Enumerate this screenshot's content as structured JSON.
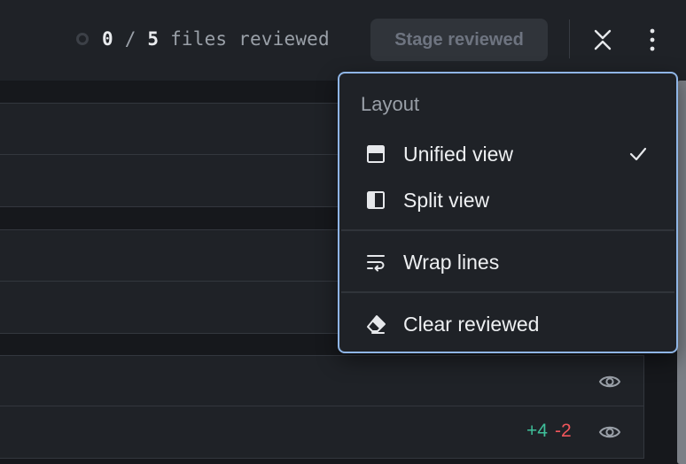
{
  "toolbar": {
    "reviewed_count": "0",
    "separator": "/",
    "total_count": "5",
    "reviewed_suffix": "files reviewed",
    "stage_label": "Stage reviewed",
    "collapse_icon": "collapse-vertical-icon",
    "more_icon": "kebab-menu-icon"
  },
  "file_rows": [
    {
      "stats": null
    },
    {
      "stats": null
    },
    {
      "stats": null
    },
    {
      "stats": null
    },
    {
      "stats": null
    },
    {
      "stats": {
        "added": "+4",
        "removed": "-2"
      }
    }
  ],
  "menu": {
    "header": "Layout",
    "items": [
      {
        "label": "Unified view",
        "icon": "unified-view-icon",
        "checked": true
      },
      {
        "label": "Split view",
        "icon": "split-view-icon",
        "checked": false
      },
      {
        "label": "Wrap lines",
        "icon": "wrap-lines-icon",
        "checked": false
      },
      {
        "label": "Clear reviewed",
        "icon": "eraser-icon",
        "checked": false
      }
    ]
  },
  "colors": {
    "menu_border": "#8fb5e6",
    "diff_added": "#3fbf9a",
    "diff_removed": "#f0565b"
  }
}
